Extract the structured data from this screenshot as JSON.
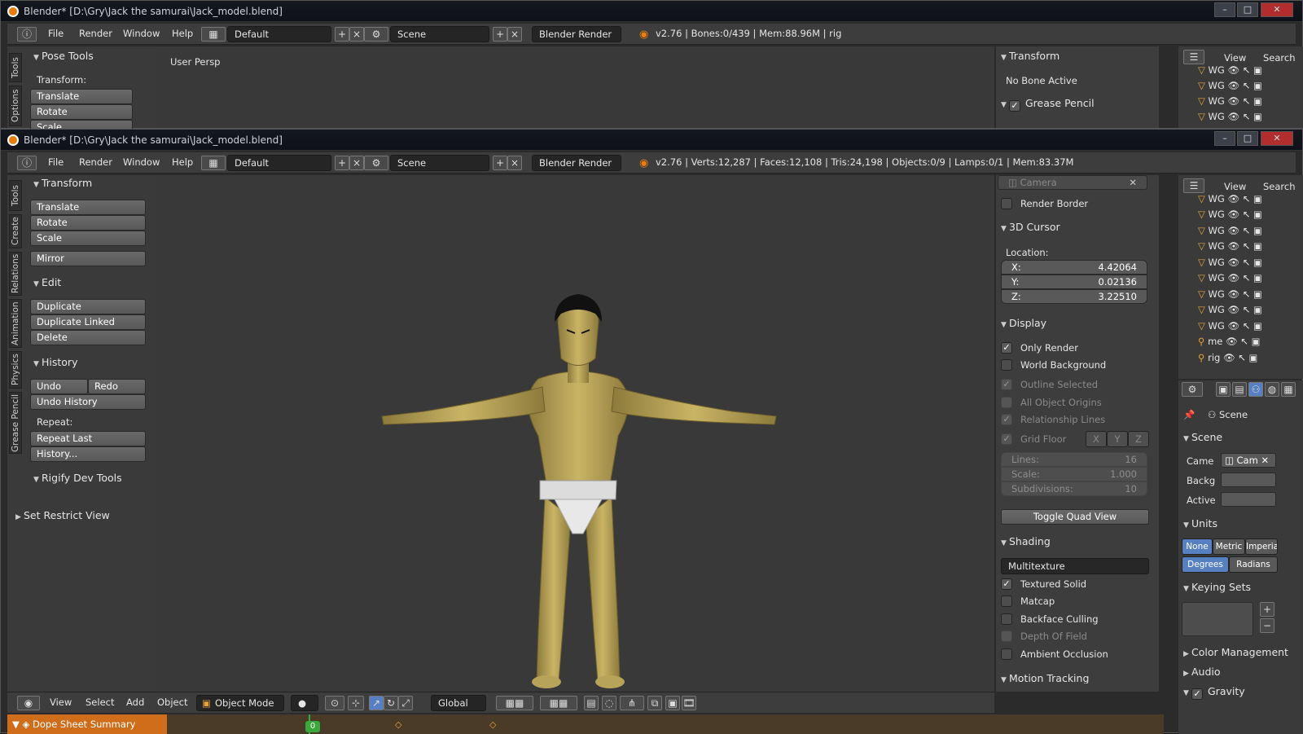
{
  "win1": {
    "title": "Blender* [D:\\Gry\\Jack the samurai\\Jack_model.blend]",
    "menu": [
      "File",
      "Render",
      "Window",
      "Help"
    ],
    "layout": "Default",
    "scene": "Scene",
    "engine": "Blender Render",
    "status": "v2.76 | Bones:0/439  | Mem:88.96M | rig",
    "left_panel_title": "Pose Tools",
    "left_label": "Transform:",
    "left_buttons": [
      "Translate",
      "Rotate",
      "Scale"
    ],
    "vtabs": [
      "Tools",
      "Options"
    ],
    "viewport_label": "User Persp",
    "right_title": "Transform",
    "no_bone": "No Bone Active",
    "grease": "Grease Pencil",
    "outliner_menu": [
      "View",
      "Search"
    ],
    "outliner_items": [
      "WG",
      "WG",
      "WG",
      "WG"
    ]
  },
  "win2": {
    "title": "Blender* [D:\\Gry\\Jack the samurai\\Jack_model.blend]",
    "menu": [
      "File",
      "Render",
      "Window",
      "Help"
    ],
    "layout": "Default",
    "scene": "Scene",
    "engine": "Blender Render",
    "status": "v2.76 | Verts:12,287 | Faces:12,108 | Tris:24,198 | Objects:0/9 | Lamps:0/1 | Mem:83.37M",
    "vtabs": [
      "Tools",
      "Create",
      "Relations",
      "Animation",
      "Physics",
      "Grease Pencil"
    ],
    "tools": {
      "transform_title": "Transform",
      "translate": "Translate",
      "rotate": "Rotate",
      "scale": "Scale",
      "mirror": "Mirror",
      "edit_title": "Edit",
      "duplicate": "Duplicate",
      "duplicate_linked": "Duplicate Linked",
      "delete": "Delete",
      "history_title": "History",
      "undo": "Undo",
      "redo": "Redo",
      "undo_history": "Undo History",
      "repeat_label": "Repeat:",
      "repeat_last": "Repeat Last",
      "history_dots": "History...",
      "rigify": "Rigify Dev Tools",
      "restrict": "Set Restrict View"
    },
    "props": {
      "camera": "Camera",
      "render_border": "Render Border",
      "cursor_title": "3D Cursor",
      "location": "Location:",
      "x_label": "X:",
      "x_val": "4.42064",
      "y_label": "Y:",
      "y_val": "0.02136",
      "z_label": "Z:",
      "z_val": "3.22510",
      "display_title": "Display",
      "only_render": "Only Render",
      "world_bg": "World Background",
      "outline_selected": "Outline Selected",
      "all_origins": "All Object Origins",
      "relationship": "Relationship Lines",
      "grid_floor": "Grid Floor",
      "axes": [
        "X",
        "Y",
        "Z"
      ],
      "lines_label": "Lines:",
      "lines_val": "16",
      "scale_label": "Scale:",
      "scale_val": "1.000",
      "subdiv_label": "Subdivisions:",
      "subdiv_val": "10",
      "quad_view": "Toggle Quad View",
      "shading_title": "Shading",
      "shading_mode": "Multitexture",
      "textured_solid": "Textured Solid",
      "matcap": "Matcap",
      "backface": "Backface Culling",
      "dof": "Depth Of Field",
      "ao": "Ambient Occlusion",
      "motion": "Motion Tracking"
    },
    "outliner_menu": [
      "View",
      "Search"
    ],
    "outliner_items": [
      "WG",
      "WG",
      "WG",
      "WG",
      "WG",
      "WG",
      "WG",
      "WG",
      "WG",
      "me",
      "rig"
    ],
    "scene_props": {
      "scene_label": "Scene",
      "scene_title": "Scene",
      "came": "Came",
      "cam_val": "Cam",
      "backg": "Backg",
      "active": "Active",
      "units_title": "Units",
      "units": [
        "None",
        "Metric",
        "Imperia"
      ],
      "angles": [
        "Degrees",
        "Radians"
      ],
      "keying": "Keying Sets",
      "color_mgmt": "Color Management",
      "audio": "Audio",
      "gravity": "Gravity"
    },
    "bottom": {
      "menu": [
        "View",
        "Select",
        "Add",
        "Object"
      ],
      "mode": "Object Mode",
      "orientation": "Global"
    },
    "timeline": {
      "label": "Dope Sheet Summary",
      "frame": "0"
    }
  }
}
